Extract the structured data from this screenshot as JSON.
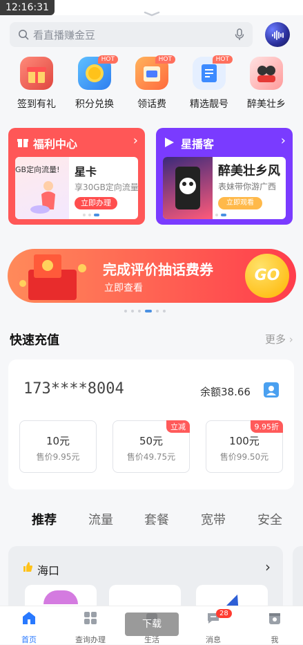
{
  "status": {
    "time": "12:16:31"
  },
  "search": {
    "placeholder": "看直播赚金豆"
  },
  "quick_entries": [
    {
      "label": "签到有礼",
      "icon": "gift-box-icon",
      "hot": ""
    },
    {
      "label": "积分兑换",
      "icon": "coin-icon",
      "hot": "HOT"
    },
    {
      "label": "领话费",
      "icon": "card-icon",
      "hot": "HOT"
    },
    {
      "label": "精选靓号",
      "icon": "document-edit-icon",
      "hot": "HOT"
    },
    {
      "label": "醉美壮乡",
      "icon": "characters-icon",
      "hot": ""
    }
  ],
  "welfare_card": {
    "title": "福利中心",
    "promo_left": "GB定向流量!",
    "name": "星卡",
    "desc": "享30GB定向流量",
    "cta": "立即办理",
    "color": "#ff5757"
  },
  "star_card": {
    "title": "星播客",
    "name": "醉美壮乡风",
    "desc": "表妹带你游广西",
    "cta": "立即观看",
    "color": "#7a3bff"
  },
  "banner": {
    "title": "完成评价抽话费券",
    "subtitle": "立即查看",
    "go": "GO"
  },
  "quick_recharge": {
    "title": "快速充值",
    "more": "更多",
    "phone": "173****8004",
    "balance": "余额38.66",
    "packages": [
      {
        "amount": "10元",
        "price": "售价9.95元",
        "tag": ""
      },
      {
        "amount": "50元",
        "price": "售价49.75元",
        "tag": "立减"
      },
      {
        "amount": "100元",
        "price": "售价99.50元",
        "tag": "9.95折"
      }
    ]
  },
  "tabs": [
    "推荐",
    "流量",
    "套餐",
    "宽带",
    "安全"
  ],
  "region": {
    "name": "海口"
  },
  "download": "下载",
  "tabbar": [
    {
      "label": "首页",
      "icon": "home-icon"
    },
    {
      "label": "查询办理",
      "icon": "grid-icon"
    },
    {
      "label": "生活",
      "icon": "life-icon"
    },
    {
      "label": "消息",
      "icon": "message-icon",
      "badge": "28"
    },
    {
      "label": "我",
      "icon": "calendar-user-icon"
    }
  ]
}
